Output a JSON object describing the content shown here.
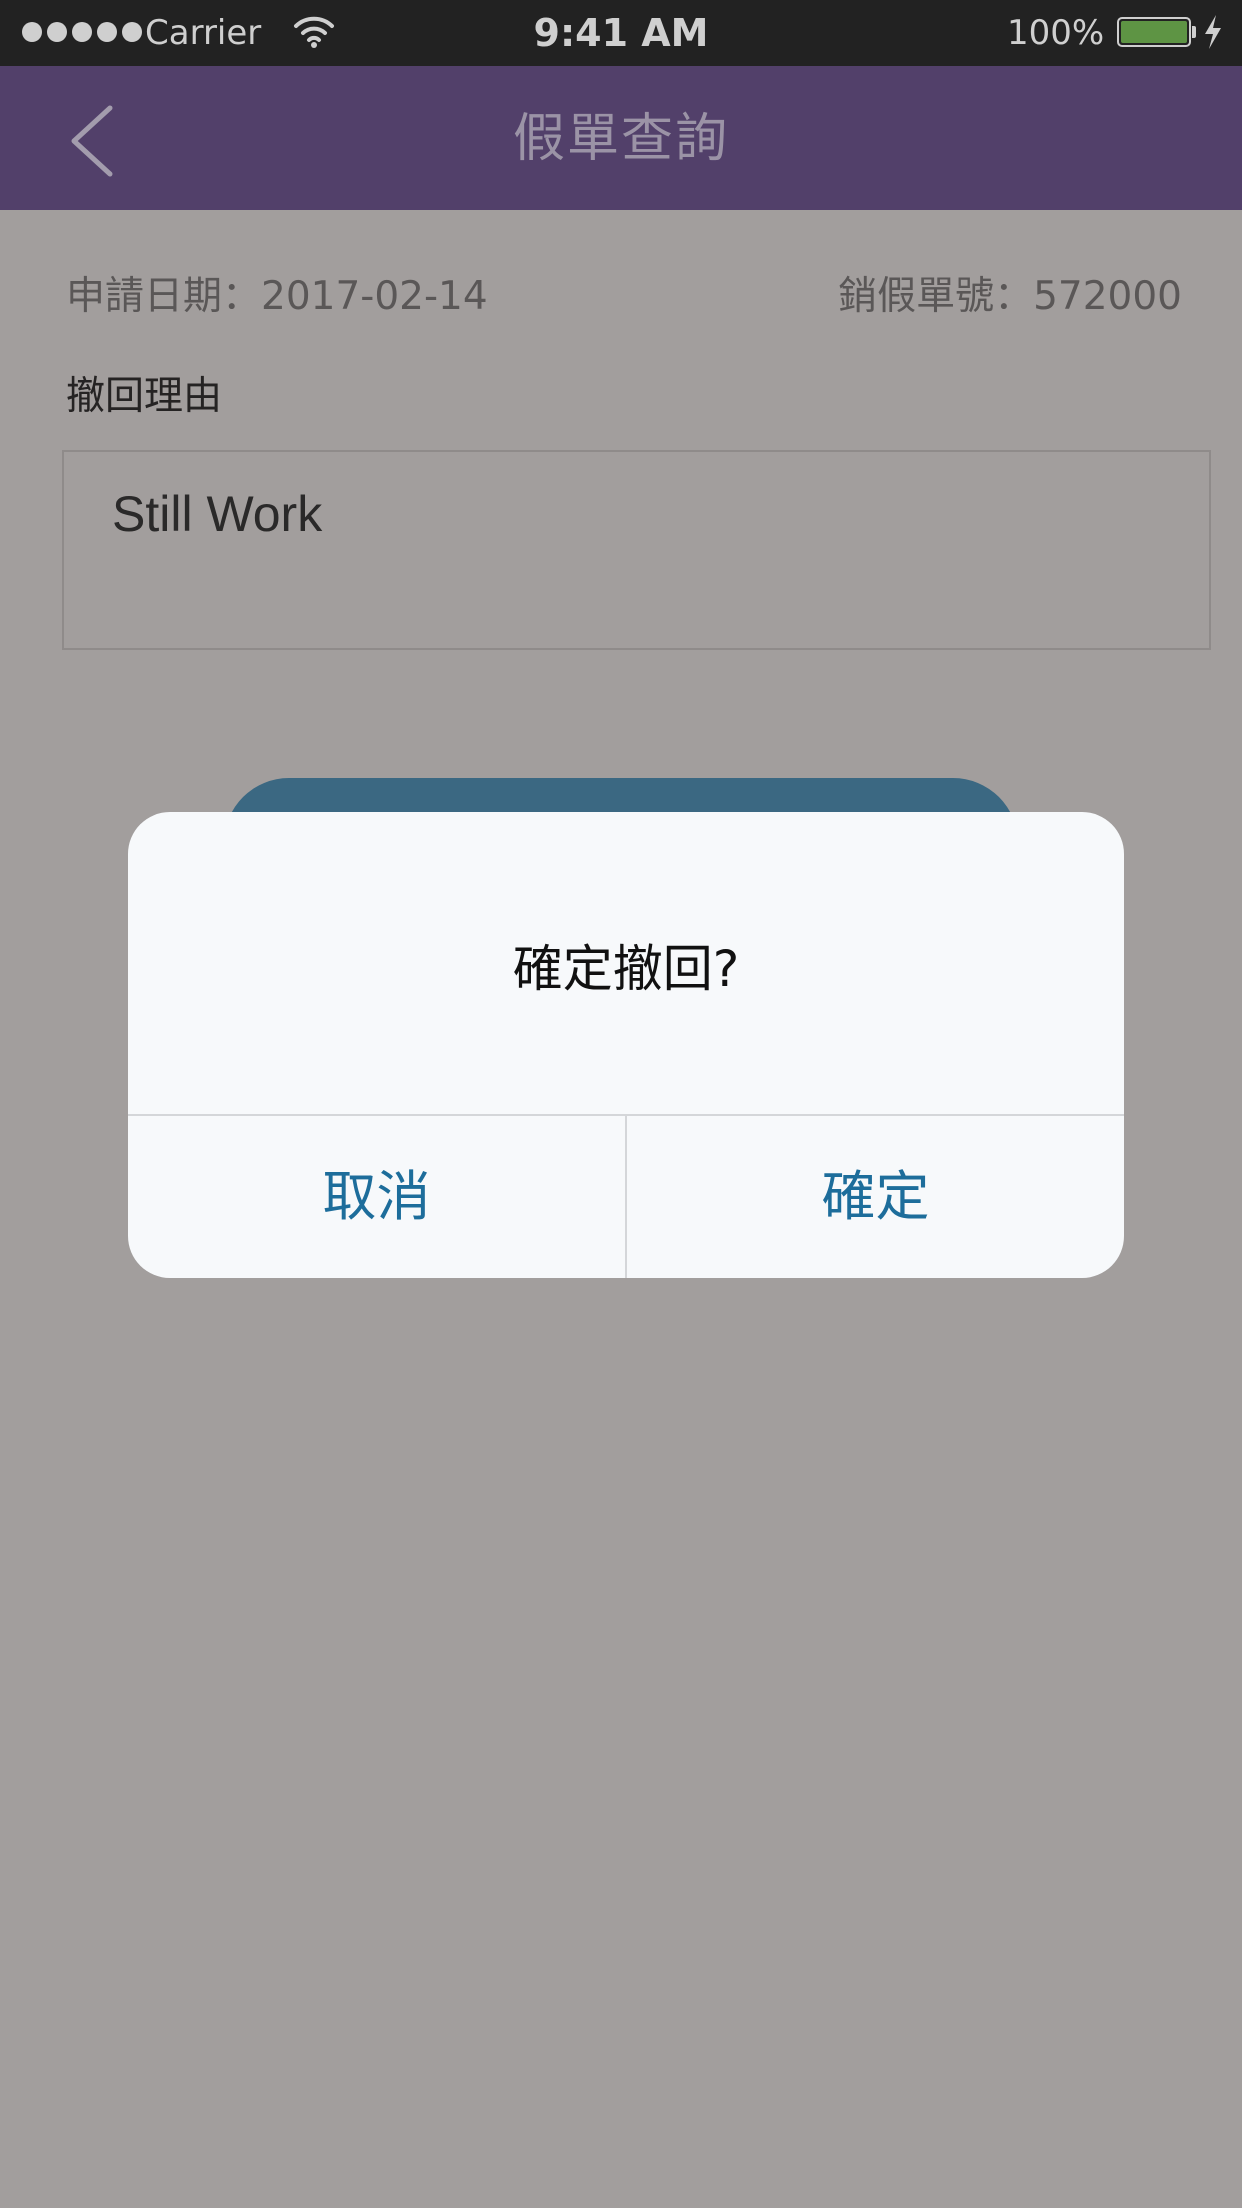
{
  "status_bar": {
    "carrier": "Carrier",
    "time": "9:41 AM",
    "battery": "100%",
    "battery_level": 1.0,
    "signal_bars": 5
  },
  "nav": {
    "title": "假單查詢",
    "back_icon": "chevron-left-icon"
  },
  "info": {
    "apply_date": "申請日期：2017-02-14",
    "cancel_no": "銷假單號：572000"
  },
  "reason": {
    "label": "撤回理由",
    "value": "Still Work"
  },
  "dialog": {
    "message": "確定撤回?",
    "cancel_label": "取消",
    "confirm_label": "確定"
  },
  "colors": {
    "nav_bg": "#52406a",
    "overlay_bg": "#a29e9d",
    "button_blue": "#3b6882",
    "dialog_text_blue": "#1d6d9b",
    "battery_green": "#5e9444"
  }
}
